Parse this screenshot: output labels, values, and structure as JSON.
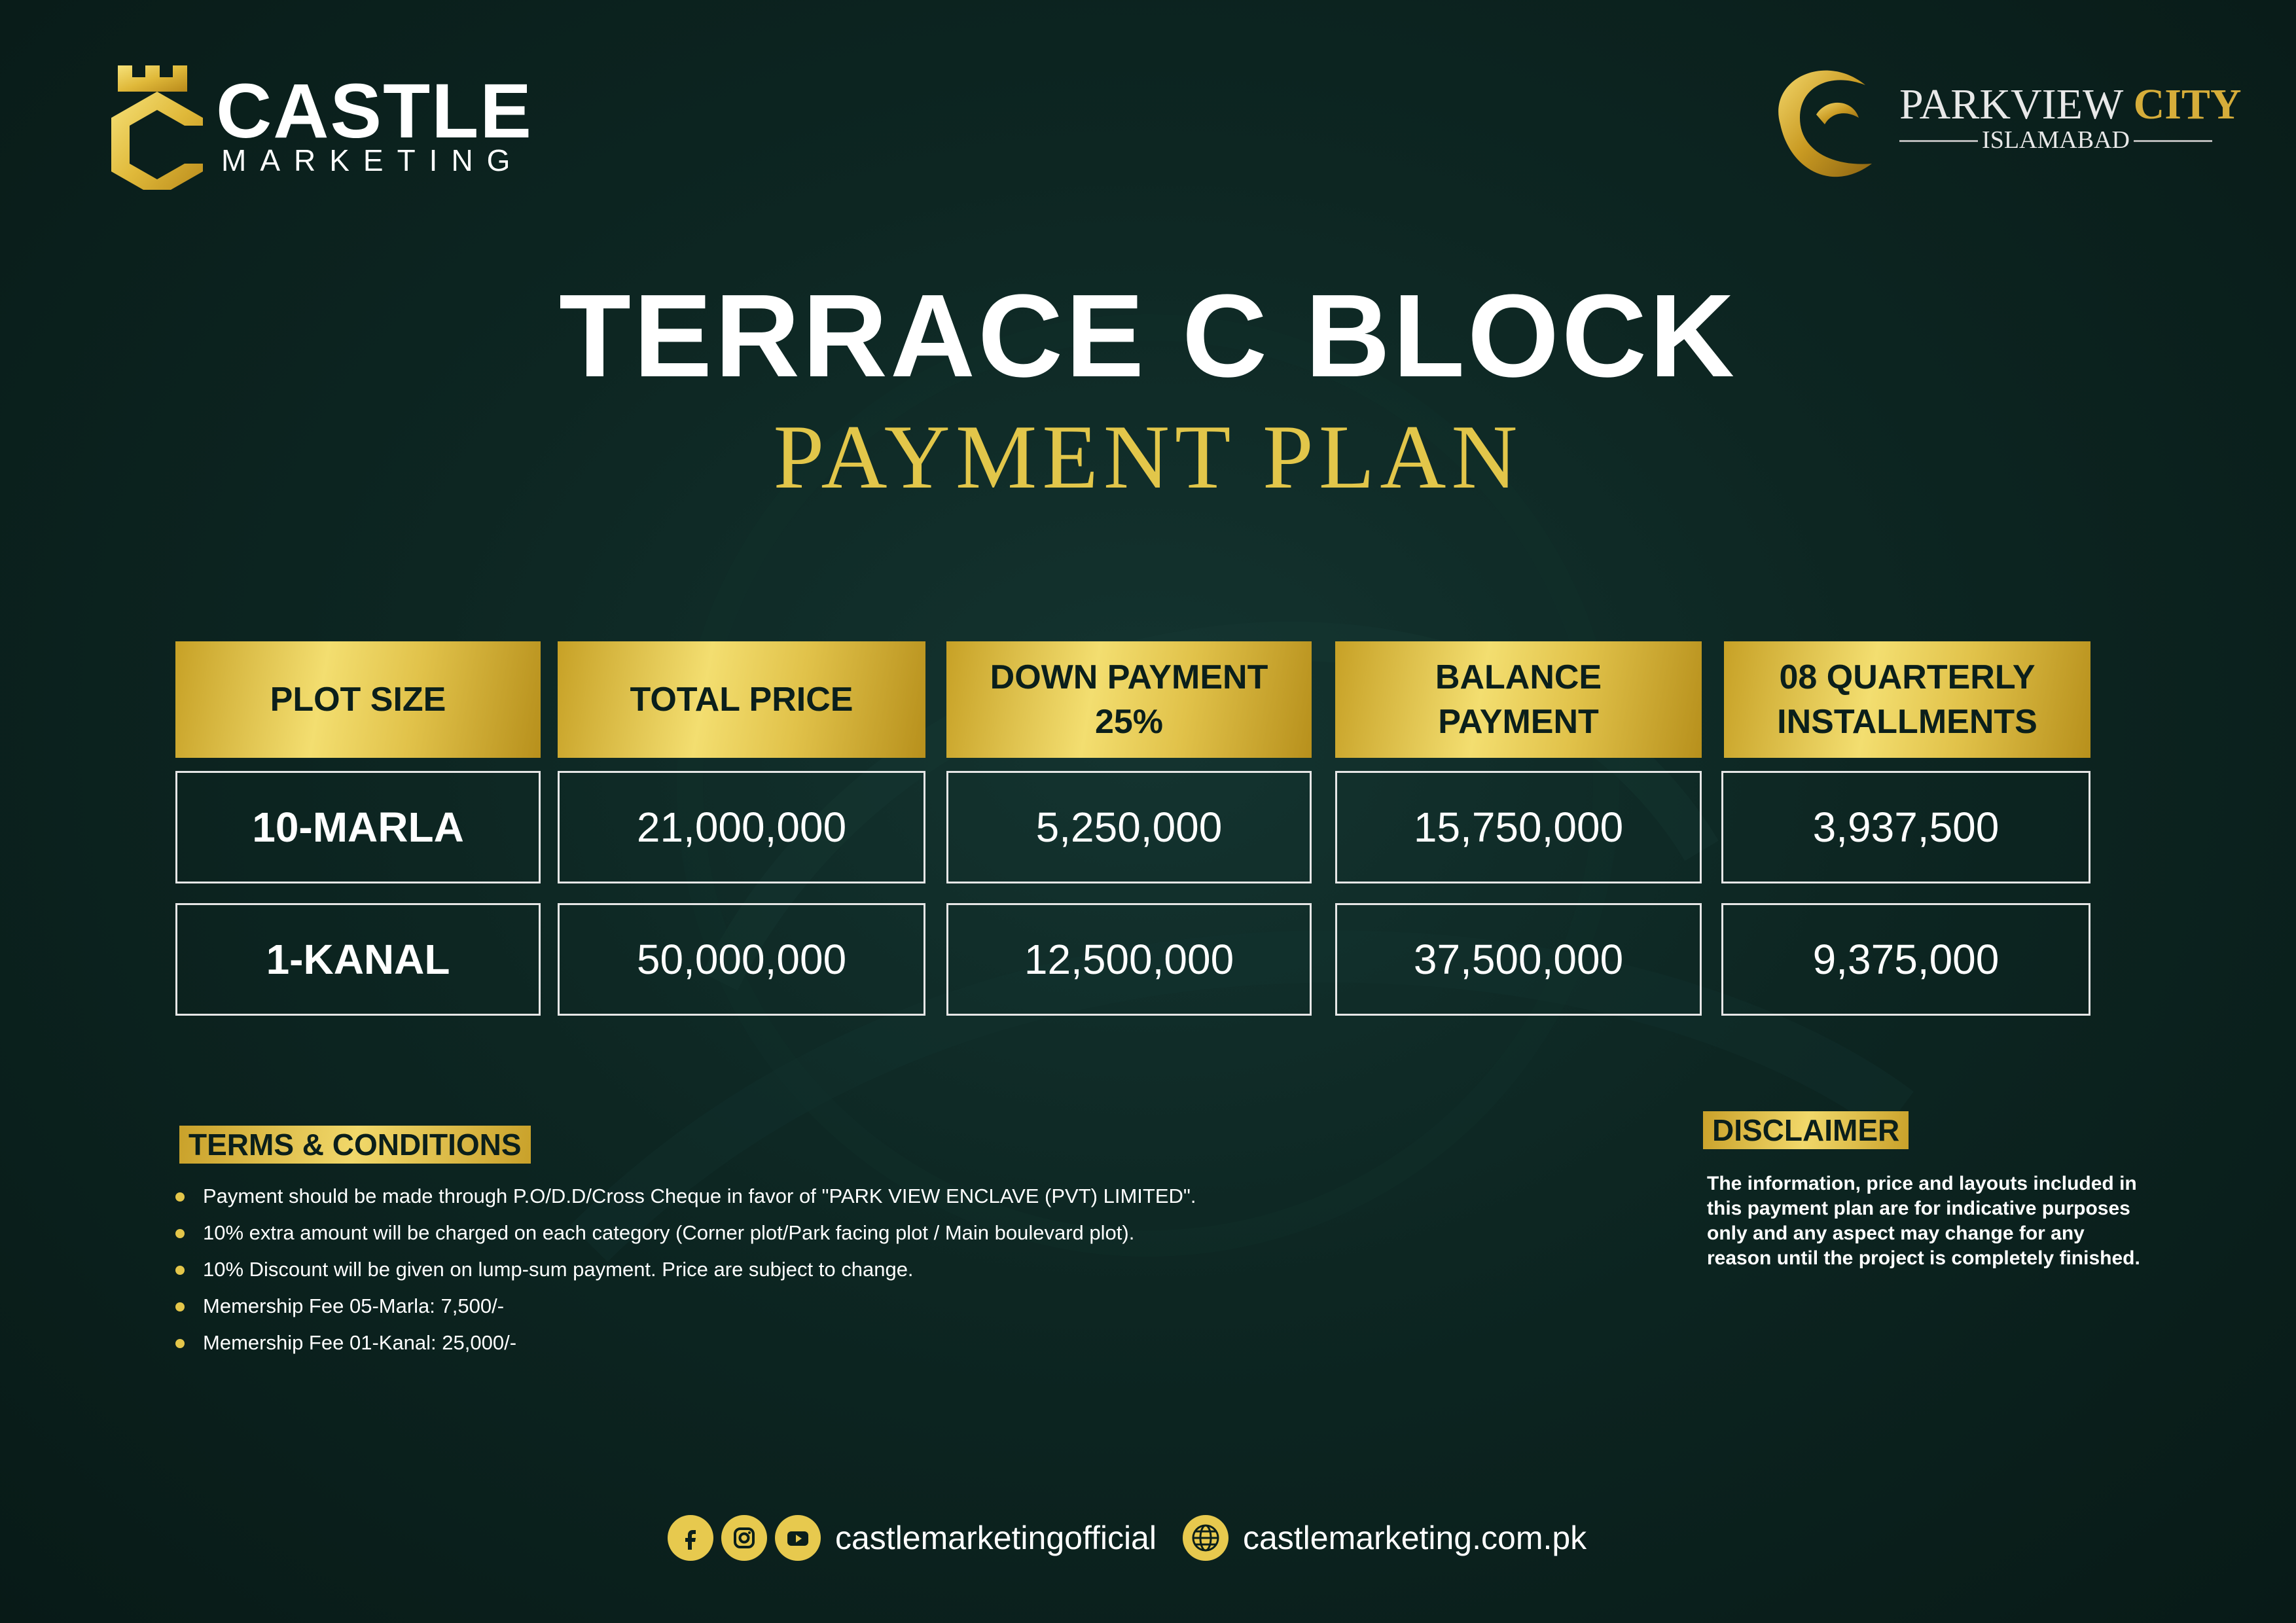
{
  "brand": {
    "castle_name": "CASTLE",
    "castle_sub": "MARKETING",
    "partner_name": "PARKVIEW",
    "partner_name_accent": "CITY",
    "partner_sub": "ISLAMABAD"
  },
  "heading": {
    "title": "TERRACE C BLOCK",
    "subtitle": "PAYMENT PLAN"
  },
  "table": {
    "headers": [
      "PLOT SIZE",
      "TOTAL PRICE",
      "DOWN PAYMENT 25%",
      "BALANCE PAYMENT",
      "08 QUARTERLY INSTALLMENTS"
    ],
    "rows": [
      [
        "10-MARLA",
        "21,000,000",
        "5,250,000",
        "15,750,000",
        "3,937,500"
      ],
      [
        "1-KANAL",
        "50,000,000",
        "12,500,000",
        "37,500,000",
        "9,375,000"
      ]
    ]
  },
  "terms": {
    "label": "TERMS & CONDITIONS",
    "items": [
      "Payment should be made through P.O/D.D/Cross Cheque in favor of \"PARK VIEW ENCLAVE (PVT) LIMITED\".",
      "10% extra amount will be charged on each category (Corner plot/Park facing plot / Main boulevard plot).",
      "10% Discount will be given on lump-sum payment. Price are subject to change.",
      "Memership Fee 05-Marla: 7,500/-",
      "Memership Fee 01-Kanal: 25,000/-"
    ]
  },
  "disclaimer": {
    "label": "DISCLAIMER",
    "text": "The information, price and layouts included in this payment plan are for indicative purposes only and any aspect may change for any reason until the project is completely finished."
  },
  "footer": {
    "social_handle": "castlemarketingofficial",
    "website": "castlemarketing.com.pk",
    "icons": [
      "facebook-icon",
      "instagram-icon",
      "youtube-icon",
      "globe-icon"
    ]
  },
  "colors": {
    "background": "#0d2622",
    "gold": "#e2c64a",
    "text": "#ffffff"
  }
}
